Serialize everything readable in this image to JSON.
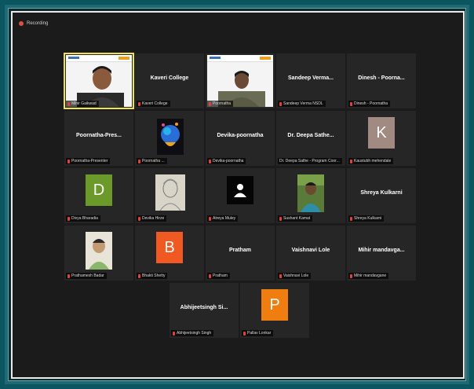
{
  "recording": {
    "label": "Recording"
  },
  "colors": {
    "avatar_D": "#6b9a2a",
    "avatar_K": "#a18a82",
    "avatar_B": "#f05a22",
    "avatar_P": "#f07d10"
  },
  "tiles": {
    "mihir": {
      "label": "Mihir Gaikwad"
    },
    "kaveri": {
      "title": "Kaveri College",
      "label": "Kaveri College"
    },
    "poornatha": {
      "label": "Poornatha"
    },
    "sandeep": {
      "title": "Sandeep Verma...",
      "label": "Sandeep Verma NSDL"
    },
    "dinesh": {
      "title": "Dinesh - Poorna...",
      "label": "Dinesh - Poornatha"
    },
    "presenter": {
      "title": "Poornatha-Pres...",
      "label": "Poornatha-Presenter"
    },
    "poornatha2": {
      "label": "Poornatha ..."
    },
    "devika": {
      "title": "Devika-poornatha",
      "label": "Devika-poornatha"
    },
    "deepa": {
      "title": "Dr. Deepa Sathe...",
      "label": "Dr. Deepa Sathe - Program Coor..."
    },
    "kaustubh": {
      "avatar": "K",
      "label": "Kaustubh mehendale"
    },
    "divya": {
      "avatar": "D",
      "label": "Divya Bharadia"
    },
    "devika_hirze": {
      "label": "Devika Hirze"
    },
    "atreya": {
      "label": "Atreya Muley"
    },
    "sushant": {
      "label": "Sushant Kamat"
    },
    "shreya": {
      "title": "Shreya Kulkarni",
      "label": "Shreya Kulkarni"
    },
    "prathamesh": {
      "label": "Prathamesh Badar"
    },
    "bhakti": {
      "avatar": "B",
      "label": "Bhakti Shetty"
    },
    "pratham": {
      "title": "Pratham",
      "label": "Pratham"
    },
    "vaishnavi": {
      "title": "Vaishnavi Lole",
      "label": "Vaishnavi Lole"
    },
    "mihir_m": {
      "title": "Mihir  mandavga...",
      "label": "Mihir mandavgane"
    },
    "abhijeet": {
      "title": "Abhijeetsingh  Si...",
      "label": "Abhijeetsingh Singh"
    },
    "pallav": {
      "avatar": "P",
      "label": "Pallav Lonkar"
    }
  }
}
